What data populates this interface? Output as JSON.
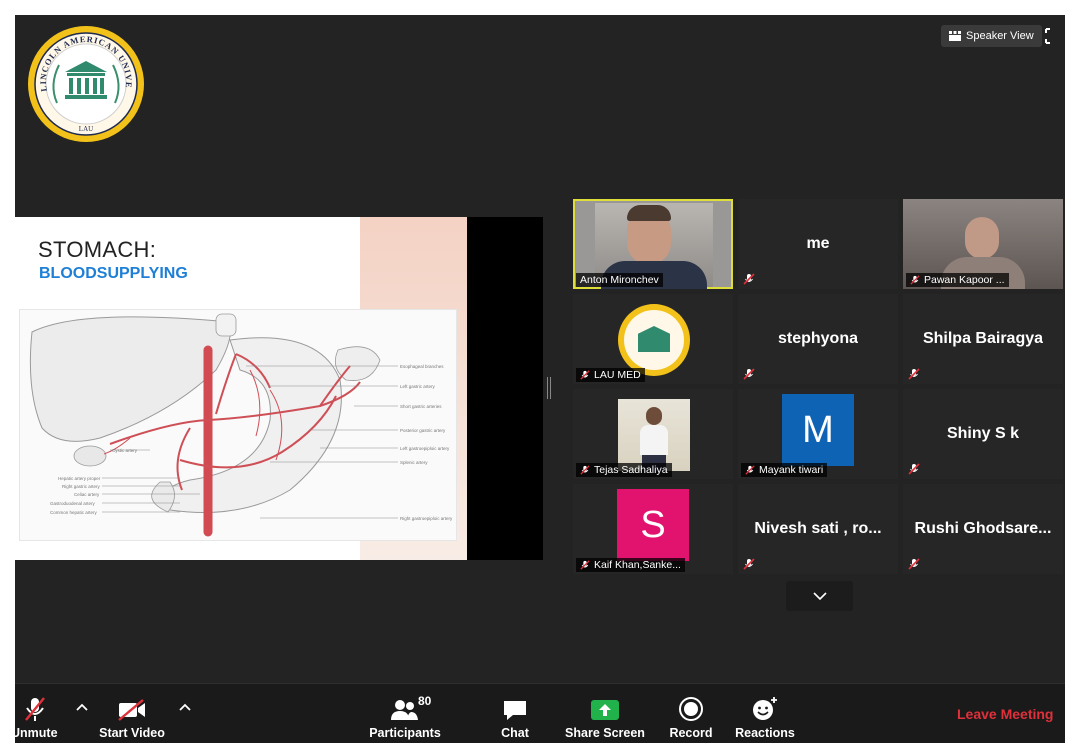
{
  "header": {
    "speaker_view_label": "Speaker View"
  },
  "logo": {
    "ring_text": "LINCOLN AMERICAN UNIVERSITY",
    "bottom_text": "LAU"
  },
  "slide": {
    "title": "STOMACH:",
    "subtitle": "BLOODSUPPLYING",
    "labels": [
      "Esophageal branches",
      "Left gastric artery",
      "Short gastric arteries",
      "Posterior gastric artery",
      "Left gastroepiploic artery",
      "Splenic artery",
      "Right gastroepiploic artery",
      "Cystic artery",
      "Hepatic artery proper",
      "Right gastric artery",
      "Celiac artery",
      "Gastroduodenal artery",
      "Common hepatic artery"
    ]
  },
  "gallery": {
    "tiles": [
      {
        "label": "Anton Mironchev",
        "kind": "video"
      },
      {
        "label": "me",
        "kind": "name",
        "muted": true
      },
      {
        "label": "Pawan Kapoor ...",
        "kind": "video",
        "muted": true
      },
      {
        "label": "LAU MED",
        "kind": "logo",
        "muted": true
      },
      {
        "label": "stephyona",
        "kind": "name",
        "muted": true
      },
      {
        "label": "Shilpa Bairagya",
        "kind": "name",
        "muted": true
      },
      {
        "label": "Tejas Sadhaliya",
        "kind": "photo",
        "muted": true
      },
      {
        "label": "Mayank tiwari",
        "kind": "avatar",
        "avatar_letter": "M",
        "avatar_color": "#0f63b5",
        "muted": true
      },
      {
        "label": "Shiny S k",
        "kind": "name",
        "muted": true
      },
      {
        "label": "Kaif Khan,Sanke...",
        "kind": "avatar",
        "avatar_letter": "S",
        "avatar_color": "#e2136e",
        "muted": true
      },
      {
        "label": "Nivesh sati , ro...",
        "kind": "name",
        "muted": true
      },
      {
        "label": "Rushi  Ghodsare...",
        "kind": "name",
        "muted": true
      }
    ]
  },
  "toolbar": {
    "unmute_label": "Unmute",
    "start_video_label": "Start Video",
    "participants_label": "Participants",
    "participants_count": "80",
    "chat_label": "Chat",
    "share_screen_label": "Share Screen",
    "record_label": "Record",
    "reactions_label": "Reactions",
    "leave_label": "Leave Meeting"
  },
  "colors": {
    "window_bg": "#232323",
    "tile_bg": "#262626",
    "active_speaker": "#dede3a",
    "share_green": "#22b24c",
    "leave_red": "#e0303a",
    "muted_red": "#e0303a"
  }
}
